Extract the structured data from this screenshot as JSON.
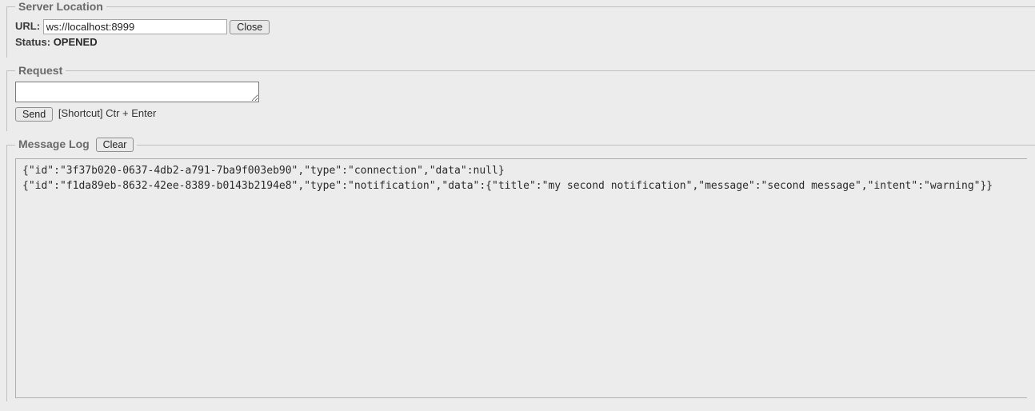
{
  "server_location": {
    "legend": "Server Location",
    "url_label": "URL:",
    "url_value": "ws://localhost:8999",
    "close_button": "Close",
    "status_label": "Status:",
    "status_value": "OPENED"
  },
  "request": {
    "legend": "Request",
    "input_value": "",
    "send_button": "Send",
    "shortcut_hint": "[Shortcut] Ctr + Enter"
  },
  "message_log": {
    "legend": "Message Log",
    "clear_button": "Clear",
    "lines": [
      "{\"id\":\"3f37b020-0637-4db2-a791-7ba9f003eb90\",\"type\":\"connection\",\"data\":null}",
      "{\"id\":\"f1da89eb-8632-42ee-8389-b0143b2194e8\",\"type\":\"notification\",\"data\":{\"title\":\"my second notification\",\"message\":\"second message\",\"intent\":\"warning\"}}"
    ]
  }
}
